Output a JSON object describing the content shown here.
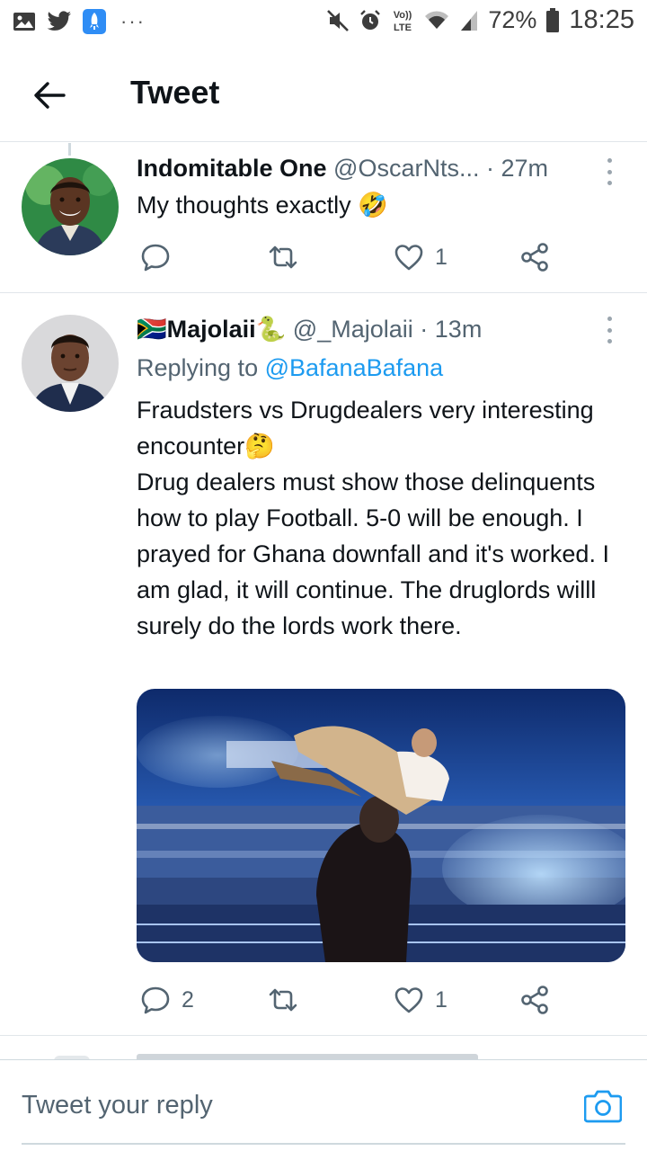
{
  "status_bar": {
    "battery": "72%",
    "time": "18:25",
    "more": "···",
    "network": "VoLTE"
  },
  "header": {
    "title": "Tweet"
  },
  "tweets": [
    {
      "name": "Indomitable One",
      "handle": "@OscarNts...",
      "separator": "·",
      "time": "27m",
      "text": "My thoughts exactly 🤣",
      "replies": "",
      "retweets": "",
      "likes": "1"
    },
    {
      "name": "🇿🇦Majolaii🐍",
      "handle": "@_Majolaii",
      "separator": "·",
      "time": "13m",
      "replying_prefix": "Replying to",
      "replying_to": "@BafanaBafana",
      "text": "Fraudsters vs Drugdealers very interesting encounter🤔\nDrug dealers must show those delinquents how to play Football. 5-0 will be enough. I prayed for Ghana downfall and it's worked. I am glad, it will continue. The druglords  willl surely do the lords work there.",
      "media_alt": "Wrestling match photo in a packed stadium",
      "replies": "2",
      "retweets": "",
      "likes": "1"
    }
  ],
  "reply_bar": {
    "placeholder": "Tweet your reply"
  },
  "colors": {
    "accent": "#1d9bf0",
    "secondary_text": "#536471",
    "divider": "#e1e6ea"
  }
}
